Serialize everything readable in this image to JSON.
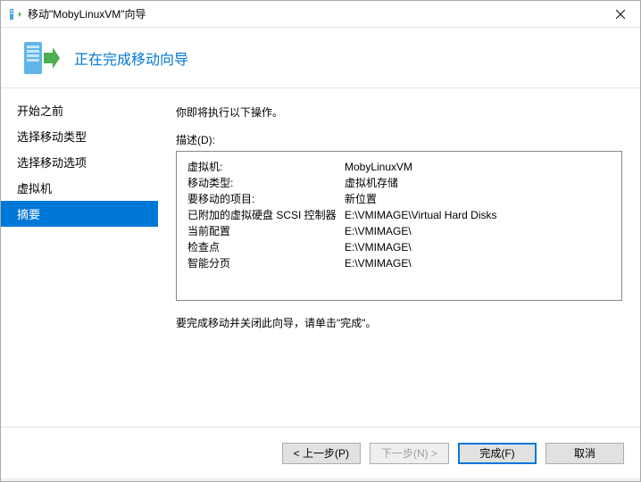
{
  "titlebar": {
    "text": "移动\"MobyLinuxVM\"向导"
  },
  "header": {
    "title": "正在完成移动向导"
  },
  "sidebar": {
    "items": [
      {
        "label": "开始之前",
        "selected": false
      },
      {
        "label": "选择移动类型",
        "selected": false
      },
      {
        "label": "选择移动选项",
        "selected": false
      },
      {
        "label": "虚拟机",
        "selected": false
      },
      {
        "label": "摘要",
        "selected": true
      }
    ]
  },
  "main": {
    "intro": "你即将执行以下操作。",
    "desc_label": "描述(D):",
    "rows": [
      {
        "label": "虚拟机:",
        "value": "MobyLinuxVM"
      },
      {
        "label": "移动类型:",
        "value": "虚拟机存储"
      },
      {
        "label": "要移动的项目:",
        "value": "新位置"
      },
      {
        "label": "已附加的虚拟硬盘 SCSI 控制器",
        "value": "E:\\VMIMAGE\\Virtual Hard Disks"
      },
      {
        "label": "当前配置",
        "value": "E:\\VMIMAGE\\"
      },
      {
        "label": "检查点",
        "value": "E:\\VMIMAGE\\"
      },
      {
        "label": "智能分页",
        "value": "E:\\VMIMAGE\\"
      }
    ],
    "footer_hint": "要完成移动并关闭此向导，请单击\"完成\"。"
  },
  "buttons": {
    "prev": "< 上一步(P)",
    "next": "下一步(N) >",
    "finish": "完成(F)",
    "cancel": "取消"
  }
}
